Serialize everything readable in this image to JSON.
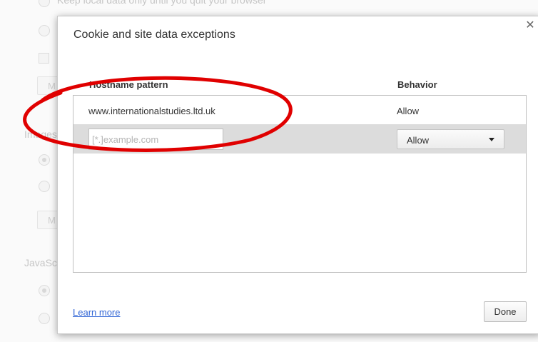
{
  "background": {
    "local_data_option": "Keep local data only until you quit your browser",
    "images_heading": "Images",
    "manage_label": "M",
    "javascript_heading": "JavaScript"
  },
  "dialog": {
    "title": "Cookie and site data exceptions",
    "close_icon": "close-icon",
    "columns": {
      "hostname": "Hostname pattern",
      "behavior": "Behavior"
    },
    "exceptions": [
      {
        "hostname": "www.internationalstudies.ltd.uk",
        "behavior": "Allow"
      }
    ],
    "new_entry": {
      "placeholder": "[*.]example.com",
      "behavior": "Allow"
    },
    "learn_more": "Learn more",
    "done": "Done"
  },
  "annotation": {
    "shape": "ellipse",
    "color": "#e00000"
  }
}
